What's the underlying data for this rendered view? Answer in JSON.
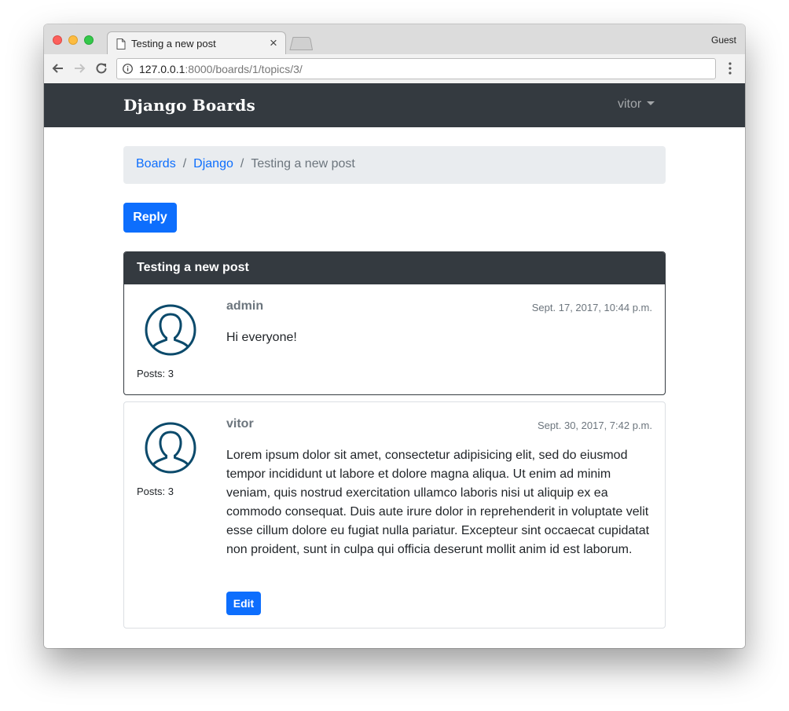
{
  "browser": {
    "tab_title": "Testing a new post",
    "profile": "Guest",
    "url_host": "127.0.0.1",
    "url_rest": ":8000/boards/1/topics/3/"
  },
  "navbar": {
    "brand": "Django Boards",
    "user": "vitor"
  },
  "breadcrumb": {
    "items": [
      "Boards",
      "Django"
    ],
    "separator": "/",
    "active": "Testing a new post"
  },
  "reply_label": "Reply",
  "topic_title": "Testing a new post",
  "posts": [
    {
      "username": "admin",
      "posts_count": "Posts: 3",
      "date": "Sept. 17, 2017, 10:44 p.m.",
      "body": "Hi everyone!"
    },
    {
      "username": "vitor",
      "posts_count": "Posts: 3",
      "date": "Sept. 30, 2017, 7:42 p.m.",
      "body": "Lorem ipsum dolor sit amet, consectetur adipisicing elit, sed do eiusmod tempor incididunt ut labore et dolore magna aliqua. Ut enim ad minim veniam, quis nostrud exercitation ullamco laboris nisi ut aliquip ex ea commodo consequat. Duis aute irure dolor in reprehenderit in voluptate velit esse cillum dolore eu fugiat nulla pariatur. Excepteur sint occaecat cupidatat non proident, sunt in culpa qui officia deserunt mollit anim id est laborum.",
      "edit_label": "Edit"
    }
  ],
  "colors": {
    "primary": "#0d6efd",
    "navbar": "#343a40",
    "breadcrumb_bg": "#e9ecef",
    "avatar": "#0b4a6b"
  },
  "icons": [
    "back-arrow-icon",
    "forward-arrow-icon",
    "reload-icon",
    "info-icon",
    "document-icon",
    "close-icon",
    "menu-dots-icon",
    "caret-down-icon",
    "user-avatar-icon"
  ]
}
